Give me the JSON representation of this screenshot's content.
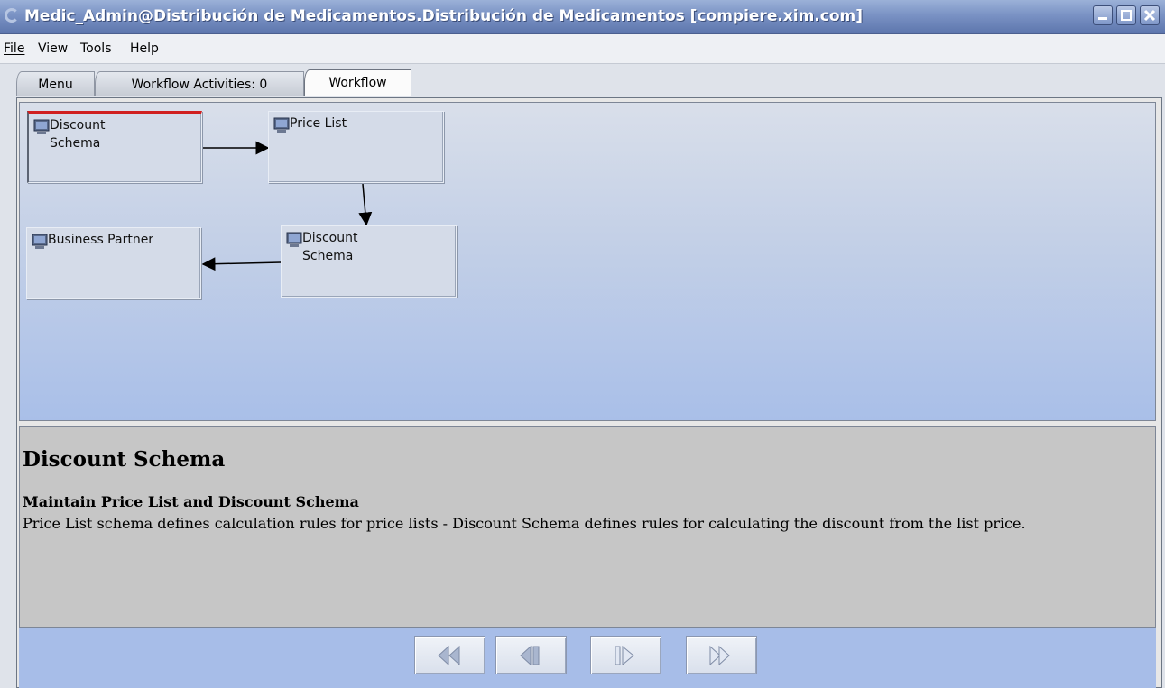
{
  "window": {
    "title": "Medic_Admin@Distribución de Medicamentos.Distribución de Medicamentos [compiere.xim.com]",
    "buttons": [
      "minimize-icon",
      "maximize-icon",
      "close-icon"
    ]
  },
  "menu": {
    "file": "File",
    "view": "View",
    "tools": "Tools",
    "help": "Help"
  },
  "tabs": [
    {
      "label": "Menu",
      "active": false
    },
    {
      "label": "Workflow Activities: 0",
      "active": false
    },
    {
      "label": "Workflow",
      "active": true
    }
  ],
  "workflow": {
    "nodes": [
      {
        "label_line1": "Discount",
        "label_line2": "Schema",
        "selected": true
      },
      {
        "label_line1": "Price List",
        "label_line2": ""
      },
      {
        "label_line1": "Discount",
        "label_line2": "Schema"
      },
      {
        "label_line1": "Business Partner",
        "label_line2": ""
      }
    ],
    "node_icon": "computer-icon"
  },
  "description": {
    "title": "Discount Schema",
    "subtitle": "Maintain Price List and Discount Schema",
    "text": "Price List schema defines calculation rules for price lists - Discount Schema defines rules for calculating the discount from the list price."
  },
  "navigation": {
    "buttons": [
      "first-icon",
      "previous-icon",
      "next-icon",
      "last-icon"
    ],
    "accent": "#a7bde8"
  }
}
